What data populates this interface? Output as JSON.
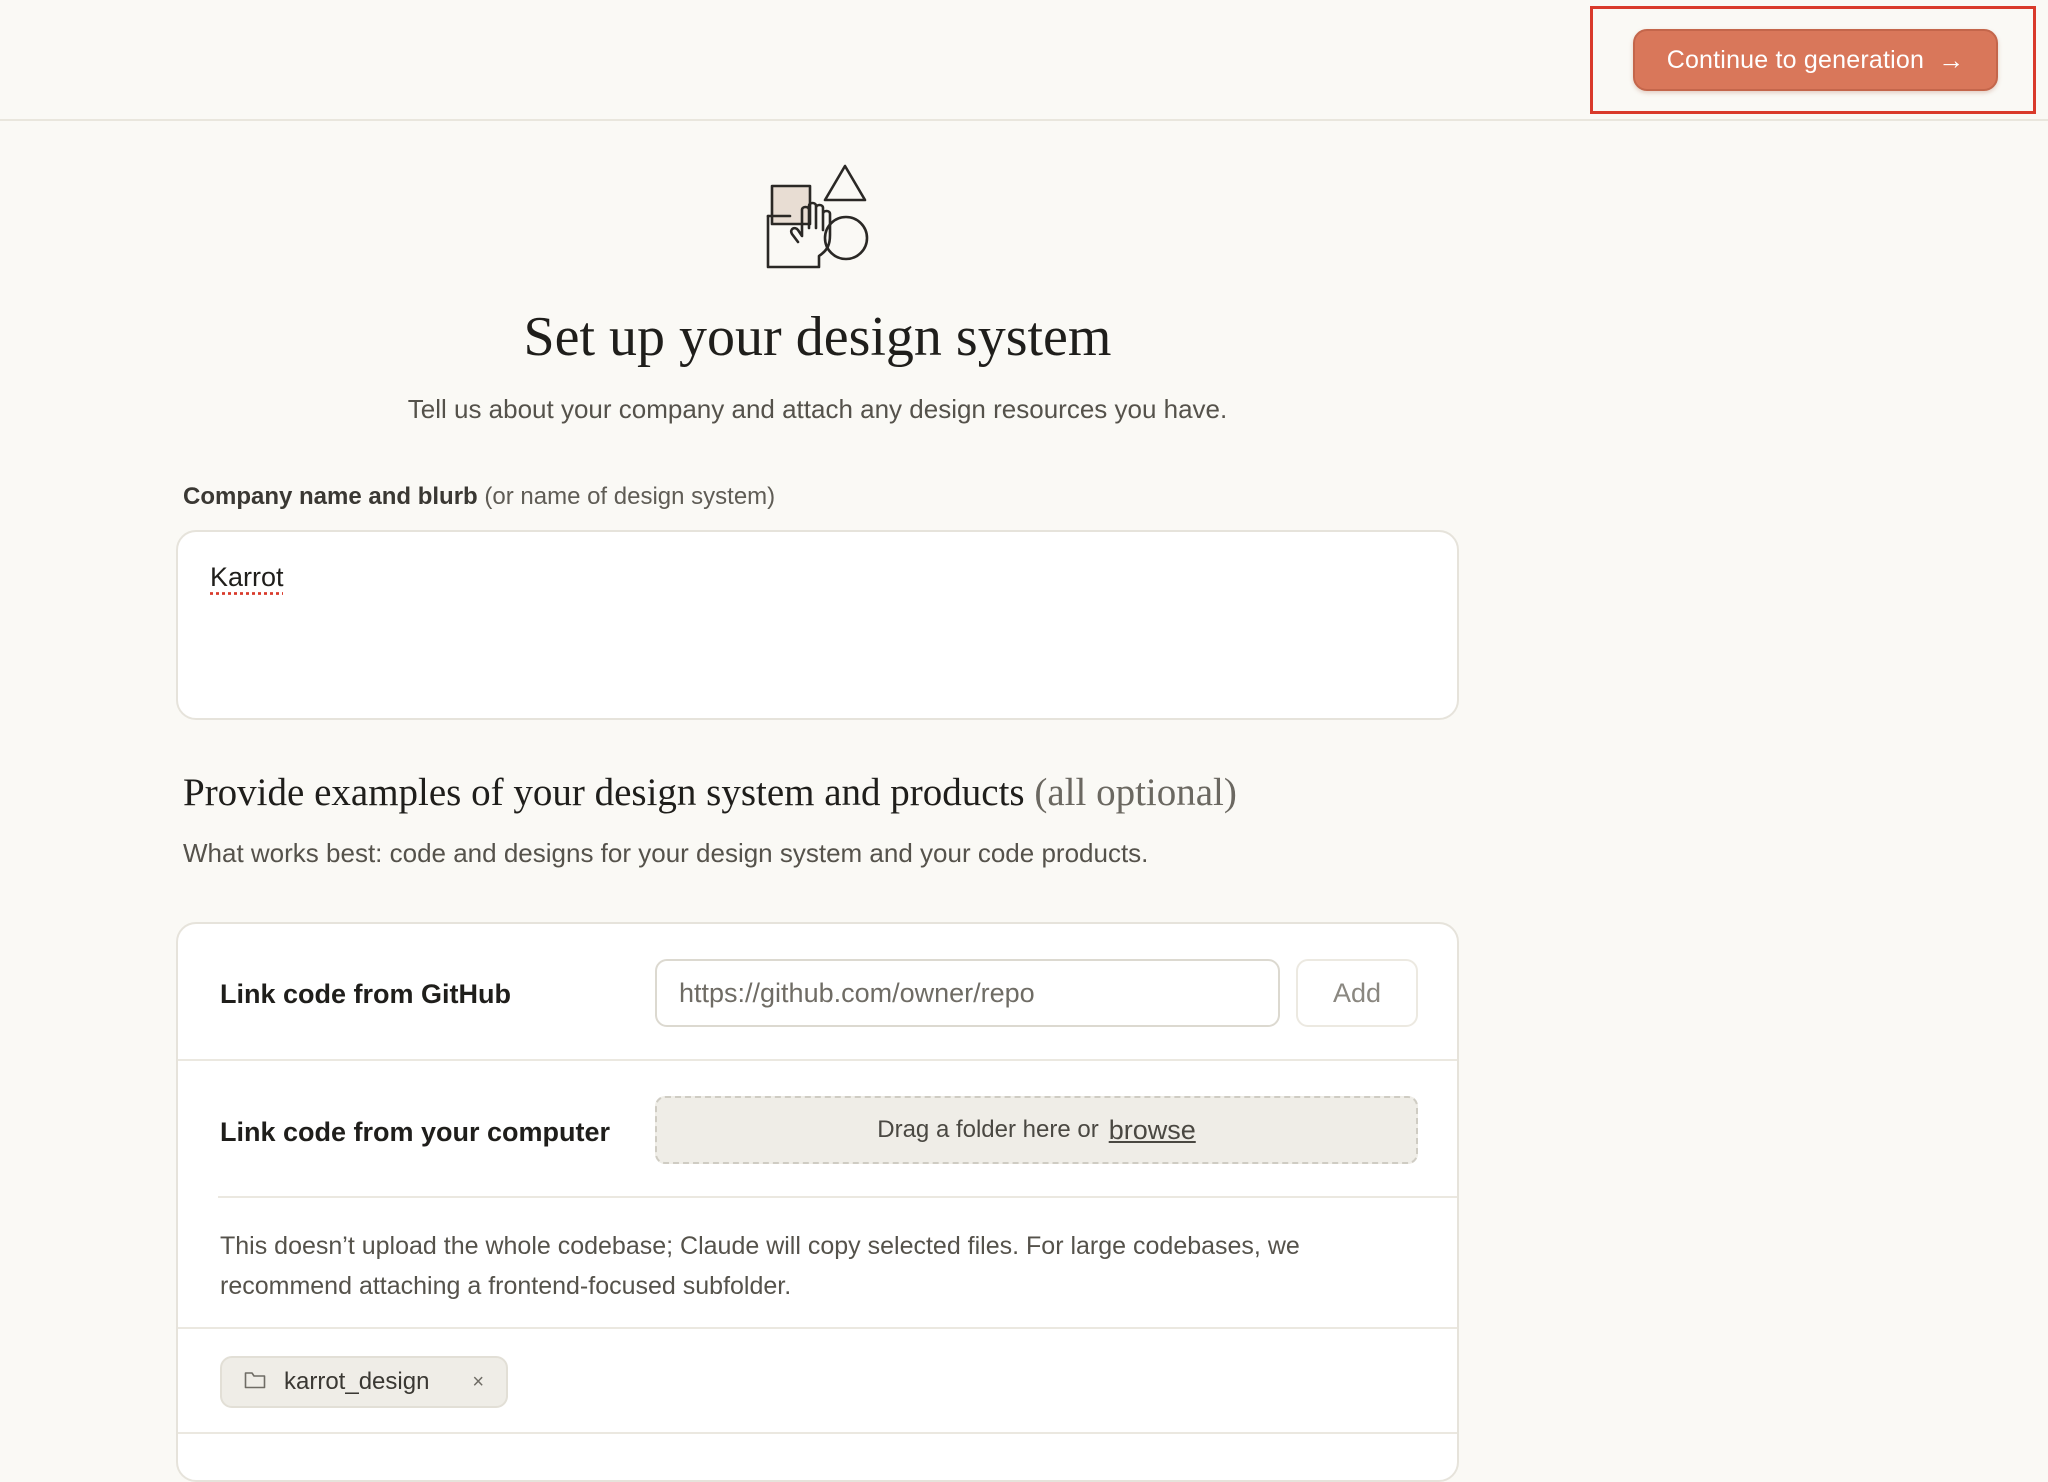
{
  "header": {
    "continue_label": "Continue to generation",
    "continue_arrow": "→"
  },
  "hero": {
    "icon": "shapes-hand-illustration",
    "title": "Set up your design system",
    "subtitle": "Tell us about your company and attach any design resources you have."
  },
  "company_field": {
    "label_bold": "Company name and blurb",
    "label_hint": "(or name of design system)",
    "value": "Karrot"
  },
  "examples": {
    "title": "Provide examples of your design system and products",
    "title_optional": "(all optional)",
    "description": "What works best: code and designs for your design system and your code products."
  },
  "github": {
    "label": "Link code from GitHub",
    "placeholder": "https://github.com/owner/repo",
    "add_label": "Add"
  },
  "computer": {
    "label": "Link code from your computer",
    "drop_text": "Drag a folder here or",
    "browse_label": "browse",
    "info": "This doesn’t upload the whole codebase; Claude will copy selected files. For large codebases, we recommend attaching a frontend-focused subfolder.",
    "attached_folder": "karrot_design",
    "remove_glyph": "×"
  },
  "colors": {
    "accent": "#d9775a",
    "highlight": "#d93a2b",
    "background": "#faf9f5"
  }
}
